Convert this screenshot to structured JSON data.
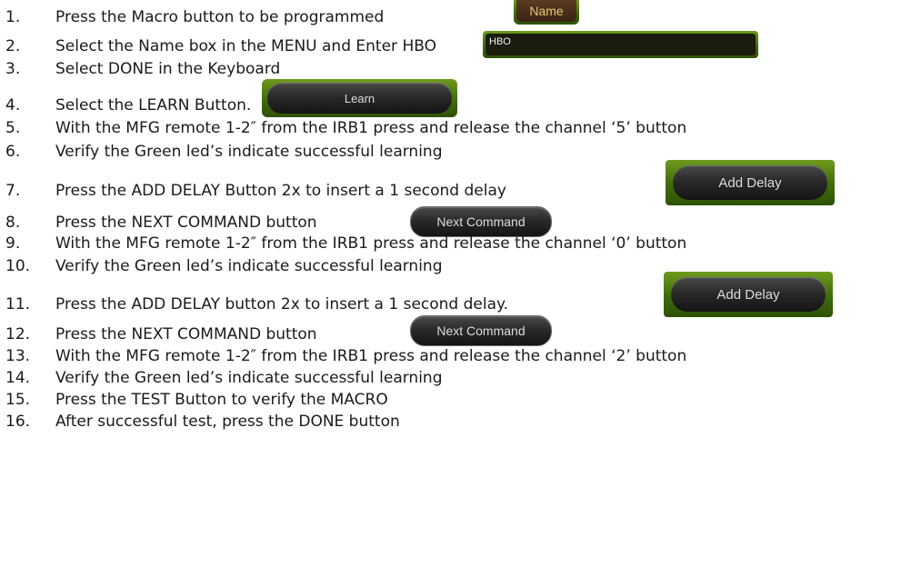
{
  "steps": [
    {
      "number": "1.",
      "text": "Press the Macro button to be programmed"
    },
    {
      "number": "2.",
      "text": "Select the Name box in the MENU and Enter HBO"
    },
    {
      "number": "3.",
      "text": "Select DONE in the Keyboard"
    },
    {
      "number": "4.",
      "text": "Select the LEARN Button."
    },
    {
      "number": "5.",
      "text": "With the MFG remote 1-2″ from the IRB1 press and release the channel ‘5’ button"
    },
    {
      "number": "6.",
      "text": "Verify the Green led’s indicate successful learning"
    },
    {
      "number": "7.",
      "text": "Press the ADD DELAY Button 2x to insert a 1 second delay"
    },
    {
      "number": "8.",
      "text": "Press the NEXT COMMAND button"
    },
    {
      "number": "9.",
      "text": "With the MFG remote 1-2″ from the IRB1 press and release the channel ‘0’ button"
    },
    {
      "number": "10.",
      "text": "Verify the Green led’s indicate successful learning"
    },
    {
      "number": "11.",
      "text": "Press the ADD DELAY button 2x to insert a 1 second delay."
    },
    {
      "number": "12.",
      "text": "Press the NEXT COMMAND button"
    },
    {
      "number": "13.",
      "text": "With the MFG remote 1-2″ from the IRB1 press and release the channel ‘2’ button"
    },
    {
      "number": "14.",
      "text": "Verify the Green led’s indicate successful learning"
    },
    {
      "number": "15.",
      "text": "Press the TEST Button to verify the MACRO"
    },
    {
      "number": "16.",
      "text": "After successful test, press the DONE button"
    }
  ],
  "buttons": {
    "name": "Name",
    "hbo_field": "HBO",
    "learn": "Learn",
    "add_delay_1": "Add Delay",
    "next_command_1": "Next Command",
    "add_delay_2": "Add Delay",
    "next_command_2": "Next Command"
  },
  "colors": {
    "frame_green": "#4a7a12",
    "name_text": "#e8c878",
    "pill_text": "#dcdcdc"
  }
}
